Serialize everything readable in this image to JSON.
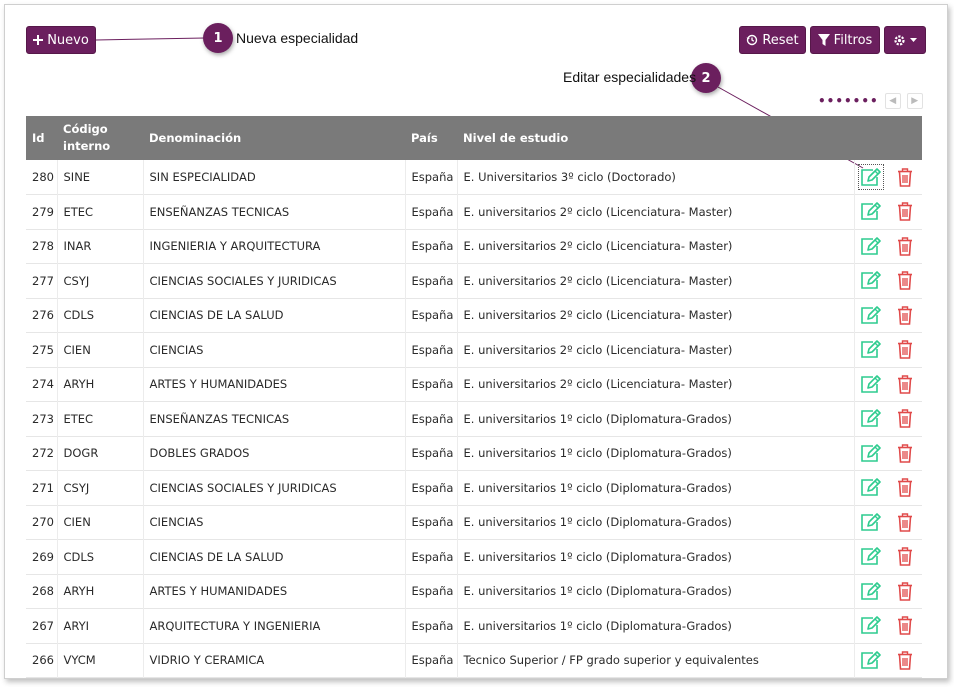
{
  "toolbar": {
    "new_label": "Nuevo",
    "reset_label": "Reset",
    "filters_label": "Filtros"
  },
  "callouts": [
    {
      "number": "1",
      "text": "Nueva especialidad"
    },
    {
      "number": "2",
      "text": "Editar especialidades"
    }
  ],
  "pager": {
    "dots": "•••••••"
  },
  "table": {
    "headers": [
      "Id",
      "Código interno",
      "Denominación",
      "País",
      "Nivel de estudio"
    ],
    "rows": [
      {
        "id": "280",
        "code": "SINE",
        "name": "SIN ESPECIALIDAD",
        "country": "España",
        "level": "E. Universitarios 3º ciclo (Doctorado)"
      },
      {
        "id": "279",
        "code": "ETEC",
        "name": "ENSEÑANZAS TECNICAS",
        "country": "España",
        "level": "E. universitarios 2º ciclo (Licenciatura- Master)"
      },
      {
        "id": "278",
        "code": "INAR",
        "name": "INGENIERIA Y ARQUITECTURA",
        "country": "España",
        "level": "E. universitarios 2º ciclo (Licenciatura- Master)"
      },
      {
        "id": "277",
        "code": "CSYJ",
        "name": "CIENCIAS SOCIALES Y JURIDICAS",
        "country": "España",
        "level": "E. universitarios 2º ciclo (Licenciatura- Master)"
      },
      {
        "id": "276",
        "code": "CDLS",
        "name": "CIENCIAS DE LA SALUD",
        "country": "España",
        "level": "E. universitarios 2º ciclo (Licenciatura- Master)"
      },
      {
        "id": "275",
        "code": "CIEN",
        "name": "CIENCIAS",
        "country": "España",
        "level": "E. universitarios 2º ciclo (Licenciatura- Master)"
      },
      {
        "id": "274",
        "code": "ARYH",
        "name": "ARTES Y HUMANIDADES",
        "country": "España",
        "level": "E. universitarios 2º ciclo (Licenciatura- Master)"
      },
      {
        "id": "273",
        "code": "ETEC",
        "name": "ENSEÑANZAS TECNICAS",
        "country": "España",
        "level": "E. universitarios 1º ciclo (Diplomatura-Grados)"
      },
      {
        "id": "272",
        "code": "DOGR",
        "name": "DOBLES GRADOS",
        "country": "España",
        "level": "E. universitarios 1º ciclo (Diplomatura-Grados)"
      },
      {
        "id": "271",
        "code": "CSYJ",
        "name": "CIENCIAS SOCIALES Y JURIDICAS",
        "country": "España",
        "level": "E. universitarios 1º ciclo (Diplomatura-Grados)"
      },
      {
        "id": "270",
        "code": "CIEN",
        "name": "CIENCIAS",
        "country": "España",
        "level": "E. universitarios 1º ciclo (Diplomatura-Grados)"
      },
      {
        "id": "269",
        "code": "CDLS",
        "name": "CIENCIAS DE LA SALUD",
        "country": "España",
        "level": "E. universitarios 1º ciclo (Diplomatura-Grados)"
      },
      {
        "id": "268",
        "code": "ARYH",
        "name": "ARTES Y HUMANIDADES",
        "country": "España",
        "level": "E. universitarios 1º ciclo (Diplomatura-Grados)"
      },
      {
        "id": "267",
        "code": "ARYI",
        "name": "ARQUITECTURA Y INGENIERIA",
        "country": "España",
        "level": "E. universitarios 1º ciclo (Diplomatura-Grados)"
      },
      {
        "id": "266",
        "code": "VYCM",
        "name": "VIDRIO Y CERAMICA",
        "country": "España",
        "level": "Tecnico Superior / FP grado superior y equivalentes"
      }
    ]
  },
  "icons": {
    "edit": "edit-icon",
    "delete": "trash-icon"
  },
  "colors": {
    "accent": "#6b1f5e",
    "header_bg": "#7a7a7a",
    "edit": "#2ecc8f",
    "delete": "#e04a4a"
  }
}
